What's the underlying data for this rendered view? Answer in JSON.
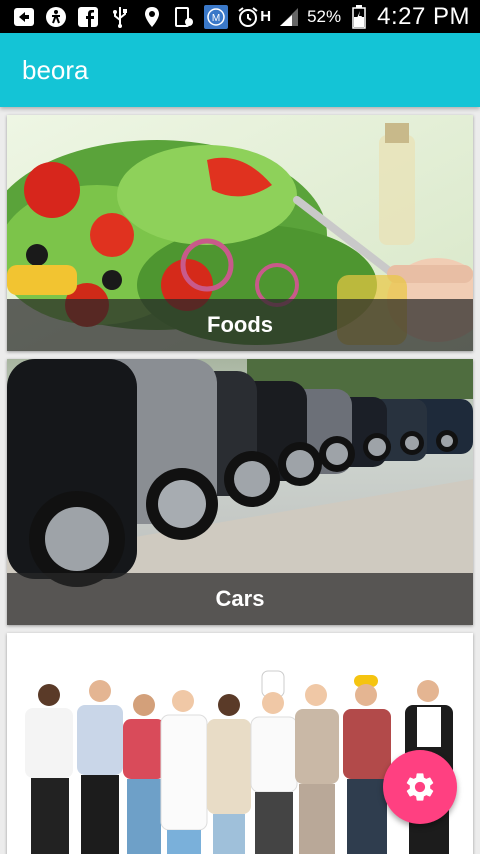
{
  "status_bar": {
    "battery_percent": "52%",
    "time": "4:27 PM",
    "network": "H",
    "icons": [
      "notification-icon",
      "accessibility-icon",
      "facebook-icon",
      "usb-icon",
      "location-icon",
      "screenshot-icon",
      "app-icon",
      "alarm-icon",
      "data-arrows-icon",
      "signal-icon",
      "battery-icon"
    ]
  },
  "app_bar": {
    "title": "beora"
  },
  "categories": [
    {
      "label": "Foods",
      "image": "salad-photo"
    },
    {
      "label": "Cars",
      "image": "cars-row-photo"
    },
    {
      "label": "",
      "image": "professions-group-photo"
    }
  ],
  "fab": {
    "icon": "gear-icon",
    "color": "#ff4081"
  },
  "colors": {
    "app_bar": "#14c4d6",
    "status_bar": "#000000",
    "background": "#ececec"
  }
}
